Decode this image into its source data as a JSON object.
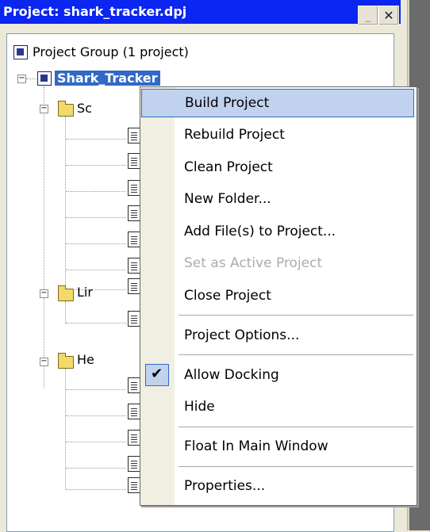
{
  "window": {
    "title": "Project: shark_tracker.dpj",
    "min_glyph": "_",
    "close_glyph": "✕"
  },
  "tree": {
    "root_label": "Project Group (1 project)",
    "project_label": "Shark_Tracker",
    "folders": [
      {
        "label_visible": "Sc"
      },
      {
        "label_visible": "Lir"
      },
      {
        "label_visible": "He"
      }
    ]
  },
  "menu": {
    "items": [
      {
        "label": "Build Project",
        "state": "hover"
      },
      {
        "label": "Rebuild Project"
      },
      {
        "label": "Clean Project"
      },
      {
        "label": "New Folder..."
      },
      {
        "label": "Add File(s) to Project..."
      },
      {
        "label": "Set as Active Project",
        "state": "disabled"
      },
      {
        "label": "Close Project"
      },
      {
        "label": "Project Options..."
      },
      {
        "label": "Allow Docking",
        "checked": true
      },
      {
        "label": "Hide"
      },
      {
        "label": "Float In Main Window"
      },
      {
        "label": "Properties..."
      }
    ],
    "check_glyph": "✔"
  },
  "colors": {
    "title_bg": "#0a26f0",
    "selection_bg": "#3169c6",
    "menu_hover_bg": "#c1d2ee",
    "menu_hover_border": "#316ac5"
  }
}
